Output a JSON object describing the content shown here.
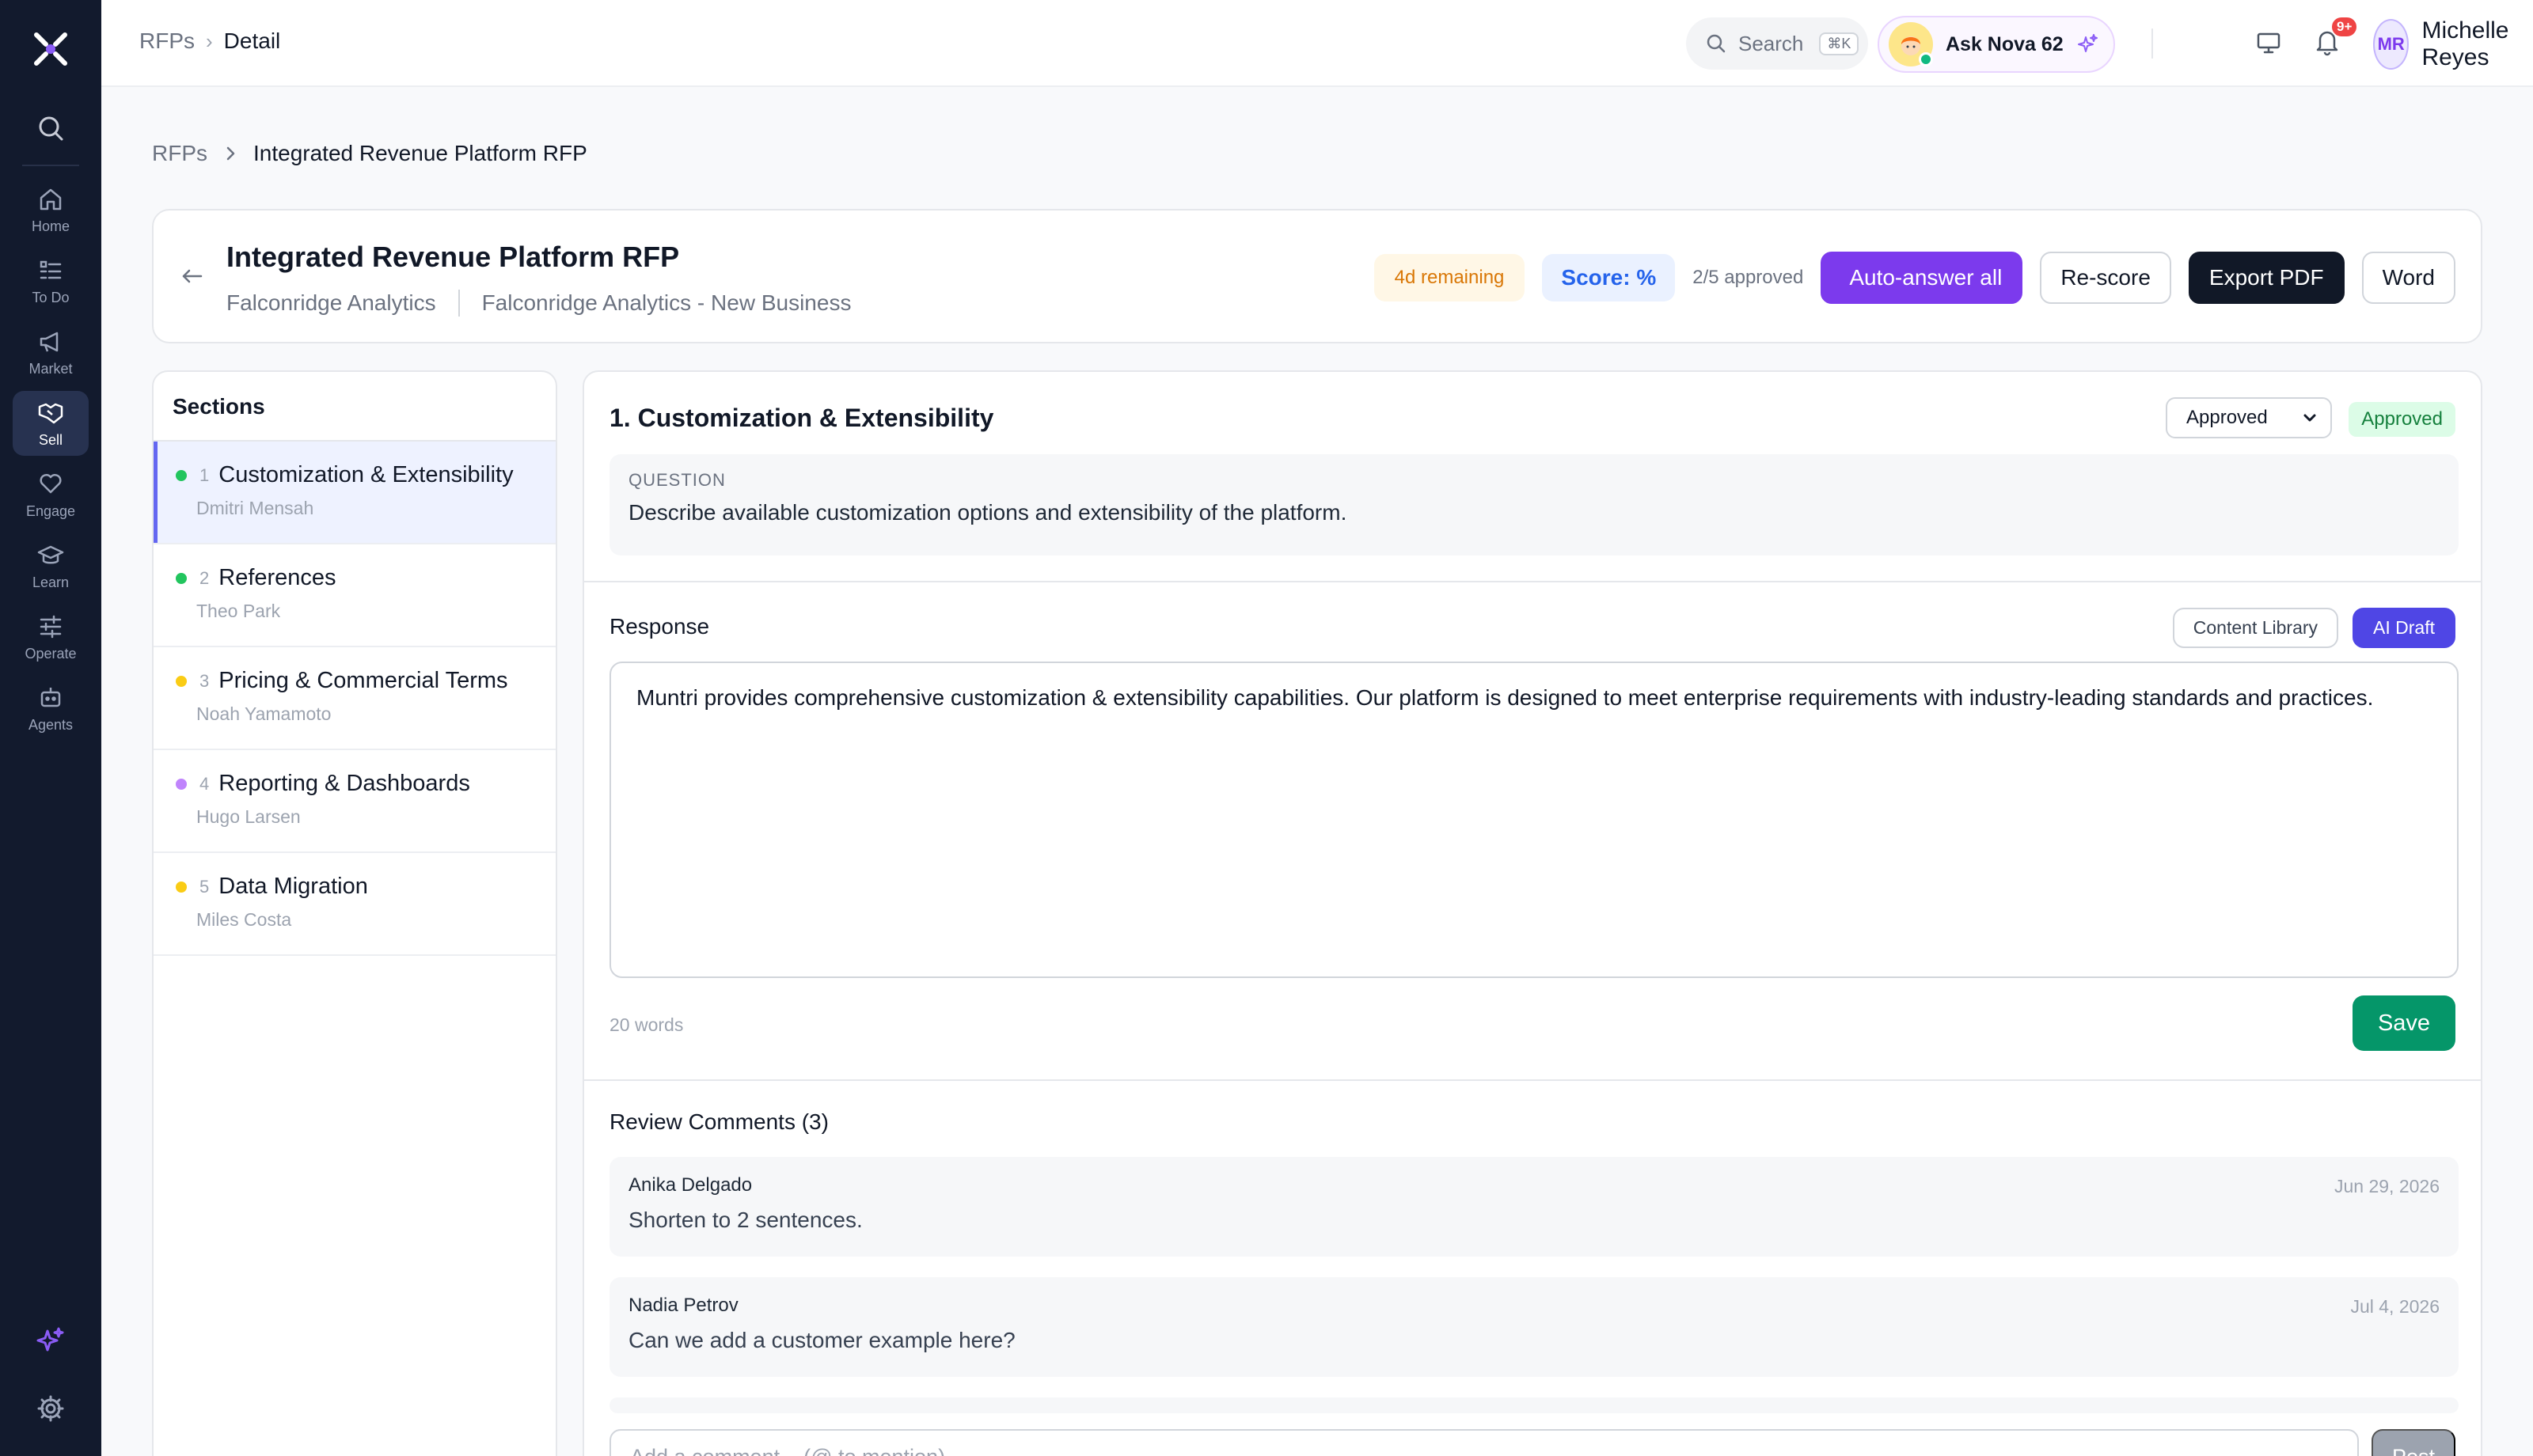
{
  "sidebar": {
    "items": [
      {
        "label": "Home",
        "icon": "home-icon"
      },
      {
        "label": "To Do",
        "icon": "list-icon"
      },
      {
        "label": "Market",
        "icon": "megaphone-icon"
      },
      {
        "label": "Sell",
        "icon": "handshake-icon",
        "active": true
      },
      {
        "label": "Engage",
        "icon": "heart-hand-icon"
      },
      {
        "label": "Learn",
        "icon": "graduation-cap-icon"
      },
      {
        "label": "Operate",
        "icon": "sliders-icon"
      },
      {
        "label": "Agents",
        "icon": "robot-icon"
      }
    ]
  },
  "topbar": {
    "breadcrumb": {
      "parent": "RFPs",
      "current": "Detail"
    },
    "search": {
      "label": "Search",
      "shortcut": "⌘K"
    },
    "assistant": {
      "label": "Ask Nova 62"
    },
    "notifications": {
      "badge": "9+"
    },
    "user": {
      "initials": "MR",
      "name": "Michelle Reyes"
    }
  },
  "page": {
    "breadcrumb": {
      "parent": "RFPs",
      "current": "Integrated Revenue Platform RFP"
    },
    "rfp": {
      "title": "Integrated Revenue Platform RFP",
      "company": "Falconridge Analytics",
      "opportunity": "Falconridge Analytics - New Business",
      "remaining": "4d remaining",
      "score": "Score: %",
      "approved": "2/5 approved"
    },
    "actions": {
      "auto_answer": "Auto-answer all",
      "auto_answer_glyph": "",
      "rescore": "Re-score",
      "export_pdf": "Export PDF",
      "word": "Word"
    }
  },
  "sections": {
    "title": "Sections",
    "items": [
      {
        "num": "1",
        "name": "Customization & Extensibility",
        "owner": "Dmitri Mensah",
        "dot": "#22c55e"
      },
      {
        "num": "2",
        "name": "References",
        "owner": "Theo Park",
        "dot": "#22c55e"
      },
      {
        "num": "3",
        "name": "Pricing & Commercial Terms",
        "owner": "Noah Yamamoto",
        "dot": "#facc15"
      },
      {
        "num": "4",
        "name": "Reporting & Dashboards",
        "owner": "Hugo Larsen",
        "dot": "#c084fc"
      },
      {
        "num": "5",
        "name": "Data Migration",
        "owner": "Miles Costa",
        "dot": "#facc15"
      }
    ]
  },
  "detail": {
    "title": "1. Customization & Extensibility",
    "status_select": "Approved",
    "status_badge": "Approved",
    "question_label": "QUESTION",
    "question": "Describe available customization options and extensibility of the platform.",
    "response_label": "Response",
    "tab_library": "Content Library",
    "tab_ai": "AI Draft",
    "response": "Muntri provides comprehensive customization & extensibility capabilities. Our platform is designed to meet enterprise requirements with industry-leading standards and practices.",
    "word_count": "20 words",
    "save": "Save",
    "comments_title": "Review Comments (3)",
    "comments": [
      {
        "author": "Anika Delgado",
        "date": "Jun 29, 2026",
        "text": "Shorten to 2 sentences."
      },
      {
        "author": "Nadia Petrov",
        "date": "Jul 4, 2026",
        "text": "Can we add a customer example here?"
      }
    ],
    "comment_placeholder": "Add a comment... (@ to mention)",
    "post": "Post"
  },
  "colors": {
    "sidebar_bg": "#121a2d",
    "accent_purple": "#7c3aed",
    "save_green": "#059669",
    "ai_tab": "#4f46e5"
  }
}
